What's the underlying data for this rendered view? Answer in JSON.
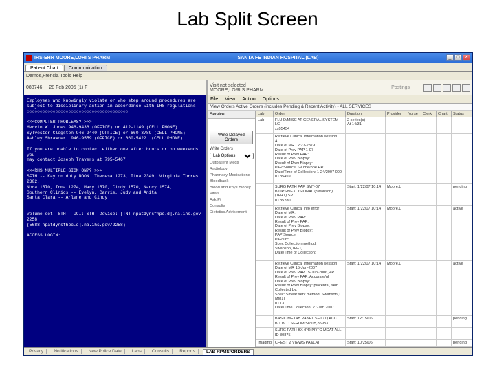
{
  "slide_title": "Lab Split Screen",
  "window": {
    "title_left": "IHS-EHR  MOORE,LORI S  PHARM",
    "title_center": "SANTA FE INDIAN HOSPITAL (LAB)",
    "btn_min": "_",
    "btn_max": "□",
    "btn_close": "×"
  },
  "tabs": {
    "active": "Patient Chart",
    "other": "Communication"
  },
  "menubar": "Demos,Frencia    Tools   Help",
  "left_header": {
    "line1": "088746",
    "line2": "28 Feb 2005 (1)   F"
  },
  "terminal": "Employees who knowingly violate or who step around procedures are\nsubject to disciplinary action in accordance with IHS regulations.\n○○○○○○○○○○○○○○○○○○○○○○○○○○○○○○○○○○○○○○○\n\n<<<COMPUTER PROBLEMS? >>>\nMervin W. Jones 946-9436 (OFFICE) or 412-1149 (CELL PHONE)\nSylvester Clogston 946-9440 (OFFICE) or 660-3789 (CELL PHONE)\nAshley Shrawder  946-9559 (OFFICE) or 660-5422  (CELL PHONE)\n\nIf you are unable to contact either one after hours or on weekends you\nmay contact Joseph Travers at 795-5467\n\n<<<RHS MULTIPLE SIGN ON?? >>>\nSFIH -- Kay on duty NOON  Theresa 1273, Tina 2349, Virginia Torres 2302,\nNora 1570, Irma 1274, Mary 1570, Cindy 1570, Nancy 1574,\nSouthern Clinics -- Evelyn, Carrie, Judy and Anita\nSanta Clara -- Arlene and Cindy\n\n\nVolume set: STH   UCI: STH  Device: [TNT npatdynsfhpc.d].na.ihs.gov 2258\n(5688 npatdynsfhpc.d].na.ihs.gov/2258)\n\nACCESS LOGIN:",
  "right_header": {
    "visit": "Visit not selected",
    "user": "MOORE,LORI S  PHARM",
    "postings": "Postings"
  },
  "right_menu": [
    "File",
    "View",
    "Action",
    "Options"
  ],
  "right_title": "View Orders    Active Orders (includes Pending & Recent Activity) - ALL SERVICES",
  "lab_side": {
    "header": "Service",
    "btn": "Write Delayed Orders",
    "write_label": "Write Orders",
    "select": "Lab Options",
    "items": [
      "Outpatient Meds",
      "Radiology",
      "Pharmacy Medications",
      "Bloodbank",
      "Blood and Phys Biopsy",
      "Vitals",
      "Ask Pt",
      "Consults",
      "Dietetics Advisement"
    ]
  },
  "columns": [
    "Lab",
    "Order",
    "Duration",
    "Provider",
    "Nurse",
    "Clerk",
    "Chart",
    "Status"
  ],
  "rows": [
    {
      "lab": "Lab",
      "order": "FLUID/MISC AT GENERAL SYSTEM LC\nxx05454",
      "duration": "2 series(s)\nAt 14/31",
      "provider": "",
      "status": ""
    },
    {
      "lab": "",
      "order": "Retrieve Clinical Information session ALL\nDate of MR : 2/27-2879\nDate of Prev PAP 1-07\nResult of Prev PAP:\nDate of Prev Biopsy:\nResult of Prev Biopsy:\nPAP Source: f-v one/one HR\nDate/Time of Collection: 1-24/2007 000\nID 85459",
      "duration": "",
      "provider": "",
      "status": ""
    },
    {
      "lab": "",
      "order": "SURG PATH PAP SMT-07\nBIOPSY/EXCISIONAL (Swanson)(1H+1) SP\nID 85280",
      "duration": "Start: 1/22/07 10:14",
      "provider": "Moore,L",
      "status": "pending"
    },
    {
      "lab": "",
      "order": "Retrieve Clinical info error\nDate of MR:\nDate of Prev PAP:\nResult of Prev PAP:\nDate of Prev Biopsy:\nResult of Prev Biopsy:\nPAP Source:\nPAP Dx:\nSpec Collection method: Swanson(1H+1)\nDate/Time of Collection:",
      "duration": "Start: 1/22/07 10:14",
      "provider": "Moore,L",
      "status": "active"
    },
    {
      "lab": "",
      "order": "Retrieve Clinical Information session\nDate of MR 15-Jun-2007\nDate of Prev PAP 15-Jun-2006, 4P\nResult of Prev PAP: Accurate/nl\nDate of Prev Biopsy:\nResult of Prev Biopsy: placental, skin\nCollected by: ___\nSpec: Smear sent method: Swanson(1 MM1)\nID 13\nDate/Time Collection: 27-Jan 2007",
      "duration": "Start: 1/22/07 10:14",
      "provider": "Moore,L",
      "status": "active"
    },
    {
      "lab": "",
      "order": "BASIC METAB PANEL SET (1) ACC\nB/T BLD SERUM SP LB,85933",
      "duration": "Start: 12/15/06",
      "provider": "",
      "status": "pending"
    },
    {
      "lab": "",
      "order": "SURG PATH BX+PR PRTC MCAT ALL\nID 80875",
      "duration": "",
      "provider": "",
      "status": ""
    },
    {
      "lab": "Imaging",
      "order": "CHEST 2 VIEWS PA&LAT",
      "duration": "Start: 10/25/06",
      "provider": "",
      "status": "pending"
    }
  ],
  "bottom_tabs": [
    "Privacy",
    "Notifications",
    "New Police Date",
    "Labs",
    "Consults",
    "Reports",
    "LAB RPMS/ORDERS"
  ]
}
